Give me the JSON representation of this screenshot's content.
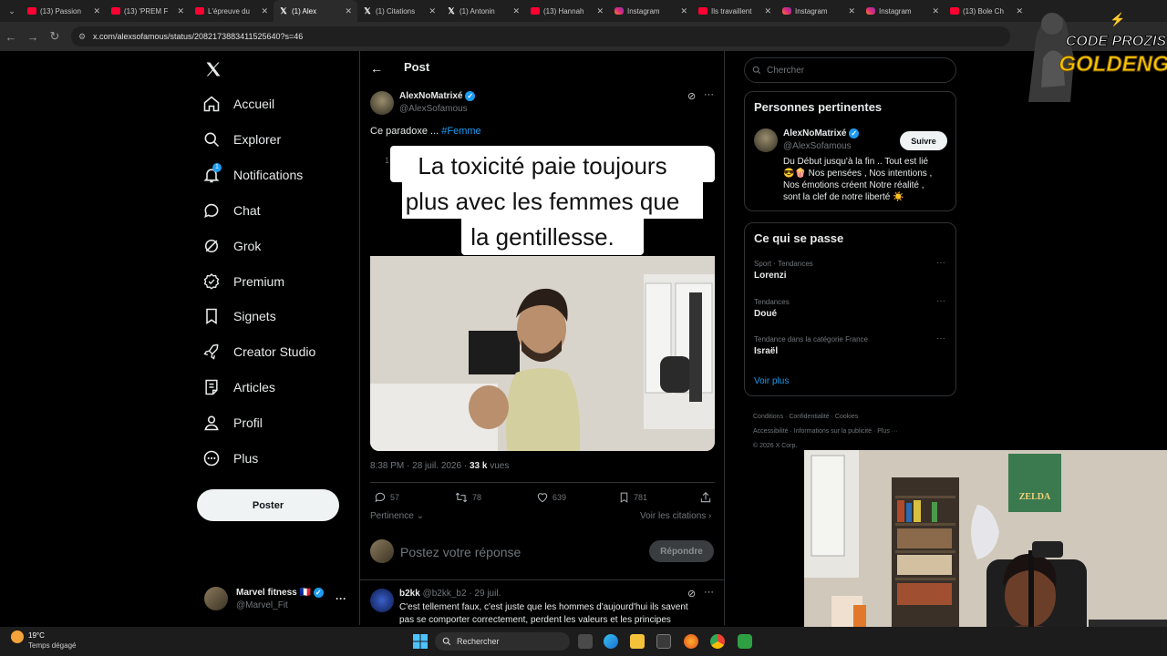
{
  "browser": {
    "tabs": [
      {
        "label": "(13) Passion",
        "favicon": "yt"
      },
      {
        "label": "(13) 'PREM F",
        "favicon": "yt"
      },
      {
        "label": "L'épreuve du",
        "favicon": "yt"
      },
      {
        "label": "(1) Alex",
        "favicon": "x",
        "active": true
      },
      {
        "label": "(1) Citations",
        "favicon": "x"
      },
      {
        "label": "(1) Antonin",
        "favicon": "x"
      },
      {
        "label": "(13) Hannah",
        "favicon": "yt"
      },
      {
        "label": "Instagram",
        "favicon": "ig"
      },
      {
        "label": "Ils travaillent",
        "favicon": "yt"
      },
      {
        "label": "Instagram",
        "favicon": "ig"
      },
      {
        "label": "Instagram",
        "favicon": "ig"
      },
      {
        "label": "(13) Bole Ch",
        "favicon": "yt"
      }
    ],
    "url": "x.com/alexsofamous/status/2082173883411525640?s=46"
  },
  "overlay_logo": {
    "line1": "CODE PROZIS",
    "line2": "GOLDENG"
  },
  "nav": {
    "items": [
      {
        "label": "Accueil",
        "icon": "home-icon"
      },
      {
        "label": "Explorer",
        "icon": "search-icon"
      },
      {
        "label": "Notifications",
        "icon": "bell-icon",
        "badge": "1"
      },
      {
        "label": "Chat",
        "icon": "chat-icon"
      },
      {
        "label": "Grok",
        "icon": "grok-icon"
      },
      {
        "label": "Premium",
        "icon": "premium-icon"
      },
      {
        "label": "Signets",
        "icon": "bookmark-icon"
      },
      {
        "label": "Creator Studio",
        "icon": "rocket-icon"
      },
      {
        "label": "Articles",
        "icon": "article-icon"
      },
      {
        "label": "Profil",
        "icon": "person-icon"
      },
      {
        "label": "Plus",
        "icon": "more-circle-icon"
      }
    ],
    "post_button": "Poster",
    "account": {
      "name": "Marvel fitness 🇫🇷",
      "handle": "@Marvel_Fit"
    }
  },
  "post": {
    "header_title": "Post",
    "author_name": "AlexNoMatrixé",
    "author_handle": "@AlexSofamous",
    "text_prefix": "Ce paradoxe ... ",
    "hashtag": "#Femme",
    "media_caption_line1": "La toxicité paie toujours",
    "media_caption_line2": "plus avec les femmes que",
    "media_caption_line3": "la gentillesse.",
    "media_timer": "1:43",
    "meta_time": "8:38 PM · 28 juil. 2026 · ",
    "meta_views_count": "33 k",
    "meta_views_label": " vues",
    "stats": {
      "replies": "57",
      "reposts": "78",
      "likes": "639",
      "bookmarks": "781"
    },
    "sort_label": "Pertinence",
    "quotes_link": "Voir les citations",
    "reply_placeholder": "Postez votre réponse",
    "reply_button": "Répondre"
  },
  "reply": {
    "author_name": "b2kk",
    "author_handle": "@b2kk_b2",
    "date": "· 29 juil.",
    "text_line1": "C'est tellement faux, c'est juste que les hommes d'aujourd'hui ils savent",
    "text_line2": "pas se comporter correctement, perdent les valeurs et les principes"
  },
  "search": {
    "placeholder": "Chercher"
  },
  "relevant": {
    "title": "Personnes pertinentes",
    "name": "AlexNoMatrixé",
    "handle": "@AlexSofamous",
    "follow_label": "Suivre",
    "bio_line1": "Du Début jusqu'à la fin .. Tout est lié",
    "bio_line2": "😎🍿 Nos pensées , Nos intentions ,",
    "bio_line3": "Nos émotions créent Notre réalité ,",
    "bio_line4": "sont la clef de notre liberté ☀️"
  },
  "trends": {
    "title": "Ce qui se passe",
    "items": [
      {
        "context": "Sport · Tendances",
        "name": "Lorenzi"
      },
      {
        "context": "Tendances",
        "name": "Doué"
      },
      {
        "context": "Tendance dans la catégorie France",
        "name": "Israël"
      }
    ],
    "more": "Voir plus"
  },
  "footer_links": {
    "row1": [
      "Conditions",
      "Confidentialité",
      "Cookies"
    ],
    "row2": [
      "Accessibilité",
      "Informations sur la publicité",
      "Plus ···"
    ],
    "copyright": "© 2026 X Corp."
  },
  "taskbar": {
    "weather_temp": "19°C",
    "weather_text": "Temps dégagé",
    "search_label": "Rechercher"
  },
  "webcam": {
    "poster_text": "ZELDA"
  },
  "colors": {
    "accent": "#1d9bf0",
    "background": "#000000",
    "border": "#2f3336",
    "muted": "#71767b"
  }
}
